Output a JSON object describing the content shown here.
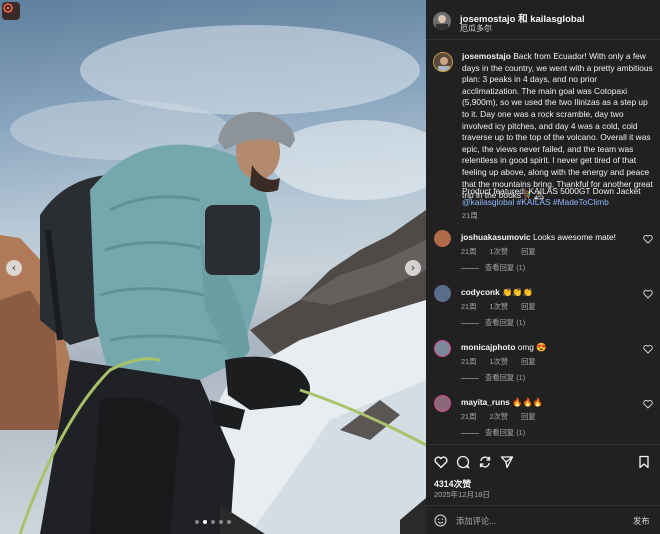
{
  "header": {
    "users": "josemostajo 和 kailasglobal",
    "location": "厄瓜多尔"
  },
  "caption": {
    "username": "josemostajo",
    "text": "Back from Ecuador! With only a few days in the country, we went with a pretty ambitious plan: 3 peaks in 4 days, and no prior acclimatization. The main goal was Cotopaxi (5,900m), so we used the two Ilinizas as a step up to it. Day one was a rock scramble, day two involved icy pitches, and day 4 was a cold, cold traverse up to the top of the volcano. Overall it was epic, the views never failed, and the team was relentless in good spirit. I never get tired of that feeling up above, along with the energy and peace that the mountains bring. Thankful for another great trip in the books 🧗‍♂️🏔",
    "product": "Product featured: KAILAS 5000GT Down Jacket",
    "tags": "@kailasglobal #KAILAS #MadeToClimb",
    "time": "21周"
  },
  "comments": [
    {
      "username": "joshuakasumovic",
      "text": "Looks awesome mate!",
      "time": "21周",
      "likes": "1次赞",
      "reply": "回复",
      "view_replies": "查看回复 (1)"
    },
    {
      "username": "codyconk",
      "text": "👏👏👏",
      "time": "21周",
      "likes": "1次赞",
      "reply": "回复",
      "view_replies": "查看回复 (1)"
    },
    {
      "username": "monicajphoto",
      "text": "omg 😍",
      "time": "21周",
      "likes": "1次赞",
      "reply": "回复",
      "view_replies": "查看回复 (1)"
    },
    {
      "username": "mayita_runs",
      "text": "🔥🔥🔥",
      "time": "21周",
      "likes": "2次赞",
      "reply": "回复",
      "view_replies": "查看回复 (1)"
    }
  ],
  "stats": {
    "likes": "4314次赞",
    "date": "2025年12月18日"
  },
  "comment_bar": {
    "placeholder": "添加评论...",
    "post": "发布"
  },
  "carousel": {
    "slides": 5,
    "active_index": 1
  },
  "icons": [
    "reels-icon",
    "chevron-left-icon",
    "chevron-right-icon",
    "heart-icon",
    "comment-icon",
    "repost-icon",
    "share-icon",
    "bookmark-icon",
    "emoji-icon"
  ],
  "colors": {
    "panel_bg": "#212121",
    "tag_link": "#8fb8ff",
    "text": "#f5f5f5",
    "muted": "#aaaaaa"
  }
}
